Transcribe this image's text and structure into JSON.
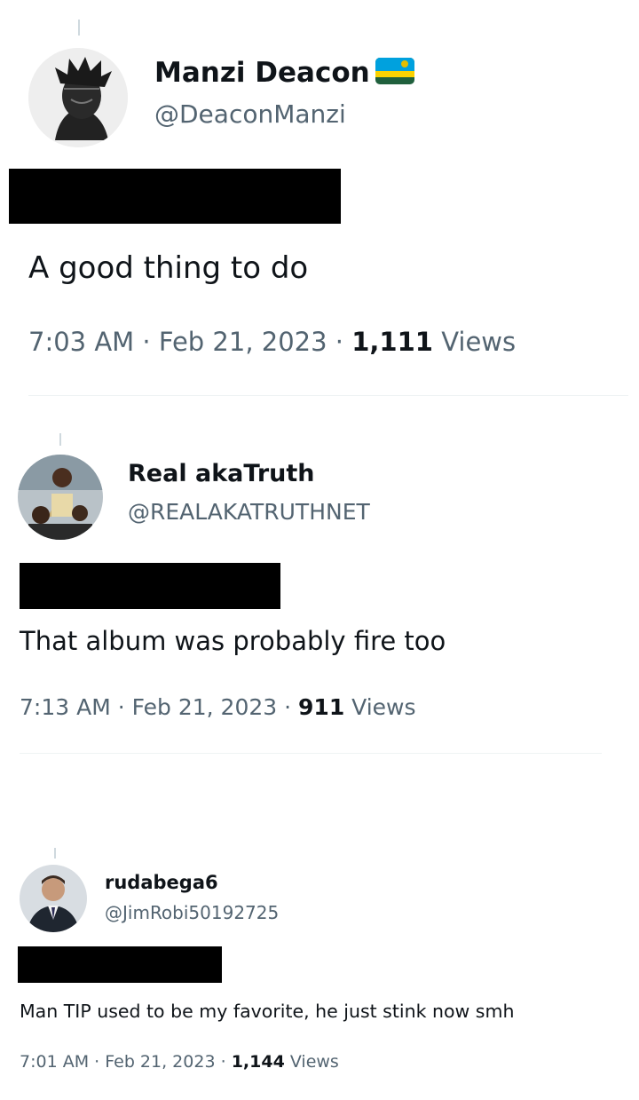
{
  "tweets": [
    {
      "display_name": "Manzi Deacon",
      "flag": "rwanda-flag-icon",
      "handle": "@DeaconManzi",
      "text": "A good thing to do",
      "time": "7:03 AM",
      "date": "Feb 21, 2023",
      "views_count": "1,111",
      "views_label": "Views"
    },
    {
      "display_name": "Real akaTruth",
      "handle": "@REALAKATRUTHNET",
      "text": "That album was probably fire too",
      "time": "7:13 AM",
      "date": "Feb 21, 2023",
      "views_count": "911",
      "views_label": "Views"
    },
    {
      "display_name": "rudabega6",
      "handle": "@JimRobi50192725",
      "text": "Man TIP used to be my favorite, he just stink now smh",
      "time": "7:01 AM",
      "date": "Feb 21, 2023",
      "views_count": "1,144",
      "views_label": "Views"
    }
  ],
  "separator": "·",
  "colors": {
    "text": "#0f1419",
    "secondary": "#536471",
    "divider": "#eff3f4",
    "thread_line": "#cfd9de",
    "redaction": "#000000"
  }
}
